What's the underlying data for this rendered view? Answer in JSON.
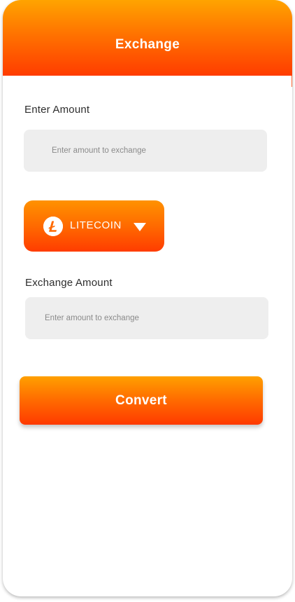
{
  "header": {
    "title": "Exchange"
  },
  "amount_section": {
    "label": "Enter Amount",
    "placeholder": "Enter amount to exchange",
    "value": ""
  },
  "coin_selector": {
    "selected": "LITECOIN",
    "icon": "litecoin-icon",
    "caret_icon": "caret-down-icon"
  },
  "exchange_section": {
    "label": "Exchange Amount",
    "placeholder": "Enter amount to exchange",
    "value": ""
  },
  "actions": {
    "convert_label": "Convert"
  },
  "colors": {
    "accent_top": "#ffa400",
    "accent_bottom": "#ff3c00",
    "input_bg": "#eeeeee"
  }
}
